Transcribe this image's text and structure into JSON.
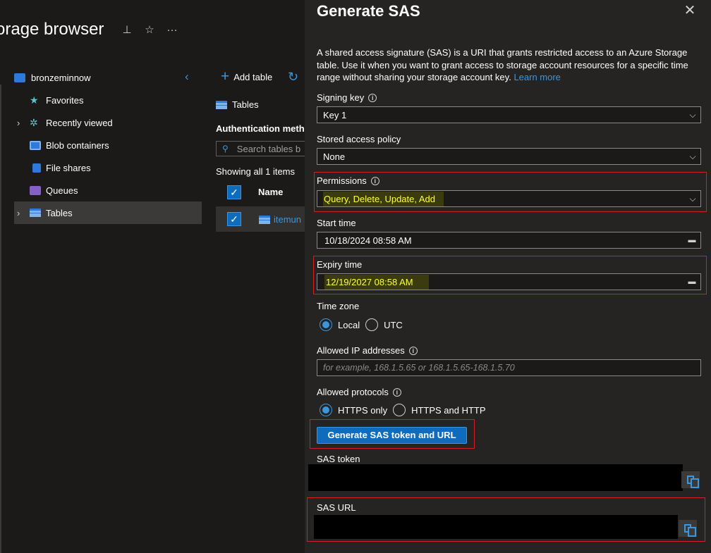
{
  "header": {
    "title": "orage browser",
    "icons": [
      "pin-icon",
      "star-icon",
      "more-icon"
    ]
  },
  "sidebar": {
    "account": "bronzeminnow",
    "items": [
      {
        "label": "Favorites",
        "icon": "favorites-icon",
        "expandable": false,
        "selected": false
      },
      {
        "label": "Recently viewed",
        "icon": "recently-viewed-icon",
        "expandable": true,
        "selected": false
      },
      {
        "label": "Blob containers",
        "icon": "blob-containers-icon",
        "expandable": false,
        "selected": false
      },
      {
        "label": "File shares",
        "icon": "file-shares-icon",
        "expandable": false,
        "selected": false
      },
      {
        "label": "Queues",
        "icon": "queues-icon",
        "expandable": false,
        "selected": false
      },
      {
        "label": "Tables",
        "icon": "tables-icon",
        "expandable": true,
        "selected": true
      }
    ]
  },
  "middle": {
    "add_table": "Add table",
    "crumb": "Tables",
    "auth_method": "Authentication metho",
    "search_placeholder": "Search tables b",
    "showing": "Showing all 1 items",
    "column_name": "Name",
    "rows": [
      {
        "name": "itemun"
      }
    ]
  },
  "panel": {
    "title": "Generate SAS",
    "description": "A shared access signature (SAS) is a URI that grants restricted access to an Azure Storage table. Use it when you want to grant access to storage account resources for a specific time range without sharing your storage account key.",
    "learn_more": "Learn more",
    "signing_key": {
      "label": "Signing key",
      "value": "Key 1"
    },
    "stored_policy": {
      "label": "Stored access policy",
      "value": "None"
    },
    "permissions": {
      "label": "Permissions",
      "value": "Query, Delete, Update, Add"
    },
    "start_time": {
      "label": "Start time",
      "value": "10/18/2024  08:58  AM"
    },
    "expiry_time": {
      "label": "Expiry time",
      "value": "12/19/2027  08:58  AM"
    },
    "time_zone": {
      "label": "Time zone",
      "options": [
        "Local",
        "UTC"
      ],
      "selected": "Local"
    },
    "allowed_ip": {
      "label": "Allowed IP addresses",
      "placeholder": "for example, 168.1.5.65 or 168.1.5.65-168.1.5.70"
    },
    "protocols": {
      "label": "Allowed protocols",
      "options": [
        "HTTPS only",
        "HTTPS and HTTP"
      ],
      "selected": "HTTPS only"
    },
    "generate_button": "Generate SAS token and URL",
    "sas_token_label": "SAS token",
    "sas_url_label": "SAS URL"
  },
  "colors": {
    "accent": "#3a96dd",
    "primary_button": "#0f6cbd",
    "highlight_text": "#ffff3a",
    "annotation_red": "#d11f28"
  }
}
